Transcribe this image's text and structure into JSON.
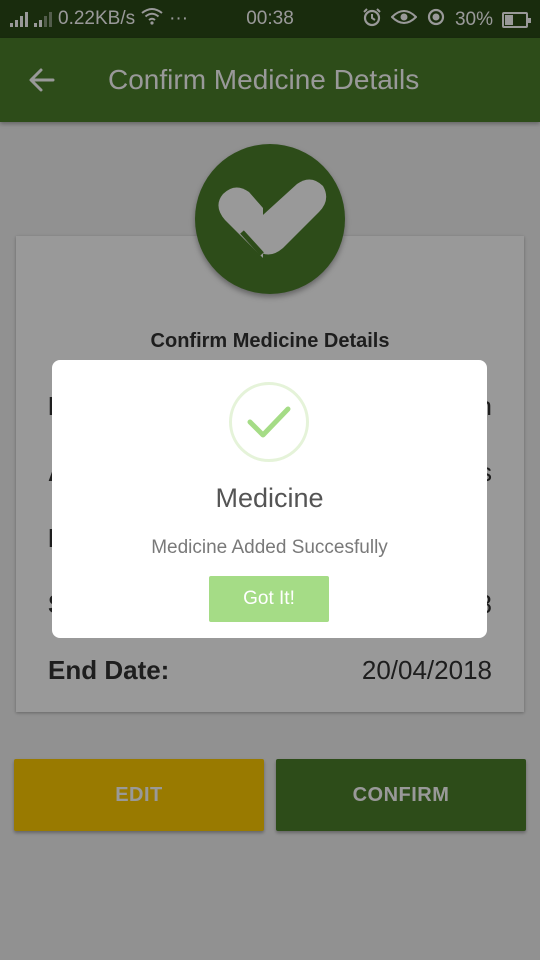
{
  "status_bar": {
    "network_speed": "0.22KB/s",
    "dots": "···",
    "time": "00:38",
    "battery": "30%"
  },
  "app_bar": {
    "title": "Confirm Medicine Details"
  },
  "card": {
    "title": "Confirm Medicine Details",
    "rows": [
      {
        "label": "N",
        "value": "n"
      },
      {
        "label": "A",
        "value": "s"
      },
      {
        "label": "D",
        "value": ""
      },
      {
        "label": "S",
        "value": "8"
      },
      {
        "label": "End Date:",
        "value": "20/04/2018"
      }
    ]
  },
  "buttons": {
    "edit": "EDIT",
    "confirm": "CONFIRM"
  },
  "dialog": {
    "title": "Medicine",
    "message": "Medicine Added Succesfully",
    "button": "Got It!"
  },
  "colors": {
    "status_bar": "#2b4a17",
    "primary": "#4b7f2b",
    "edit_button": "#ffcc00",
    "success_green": "#a5dc86"
  }
}
